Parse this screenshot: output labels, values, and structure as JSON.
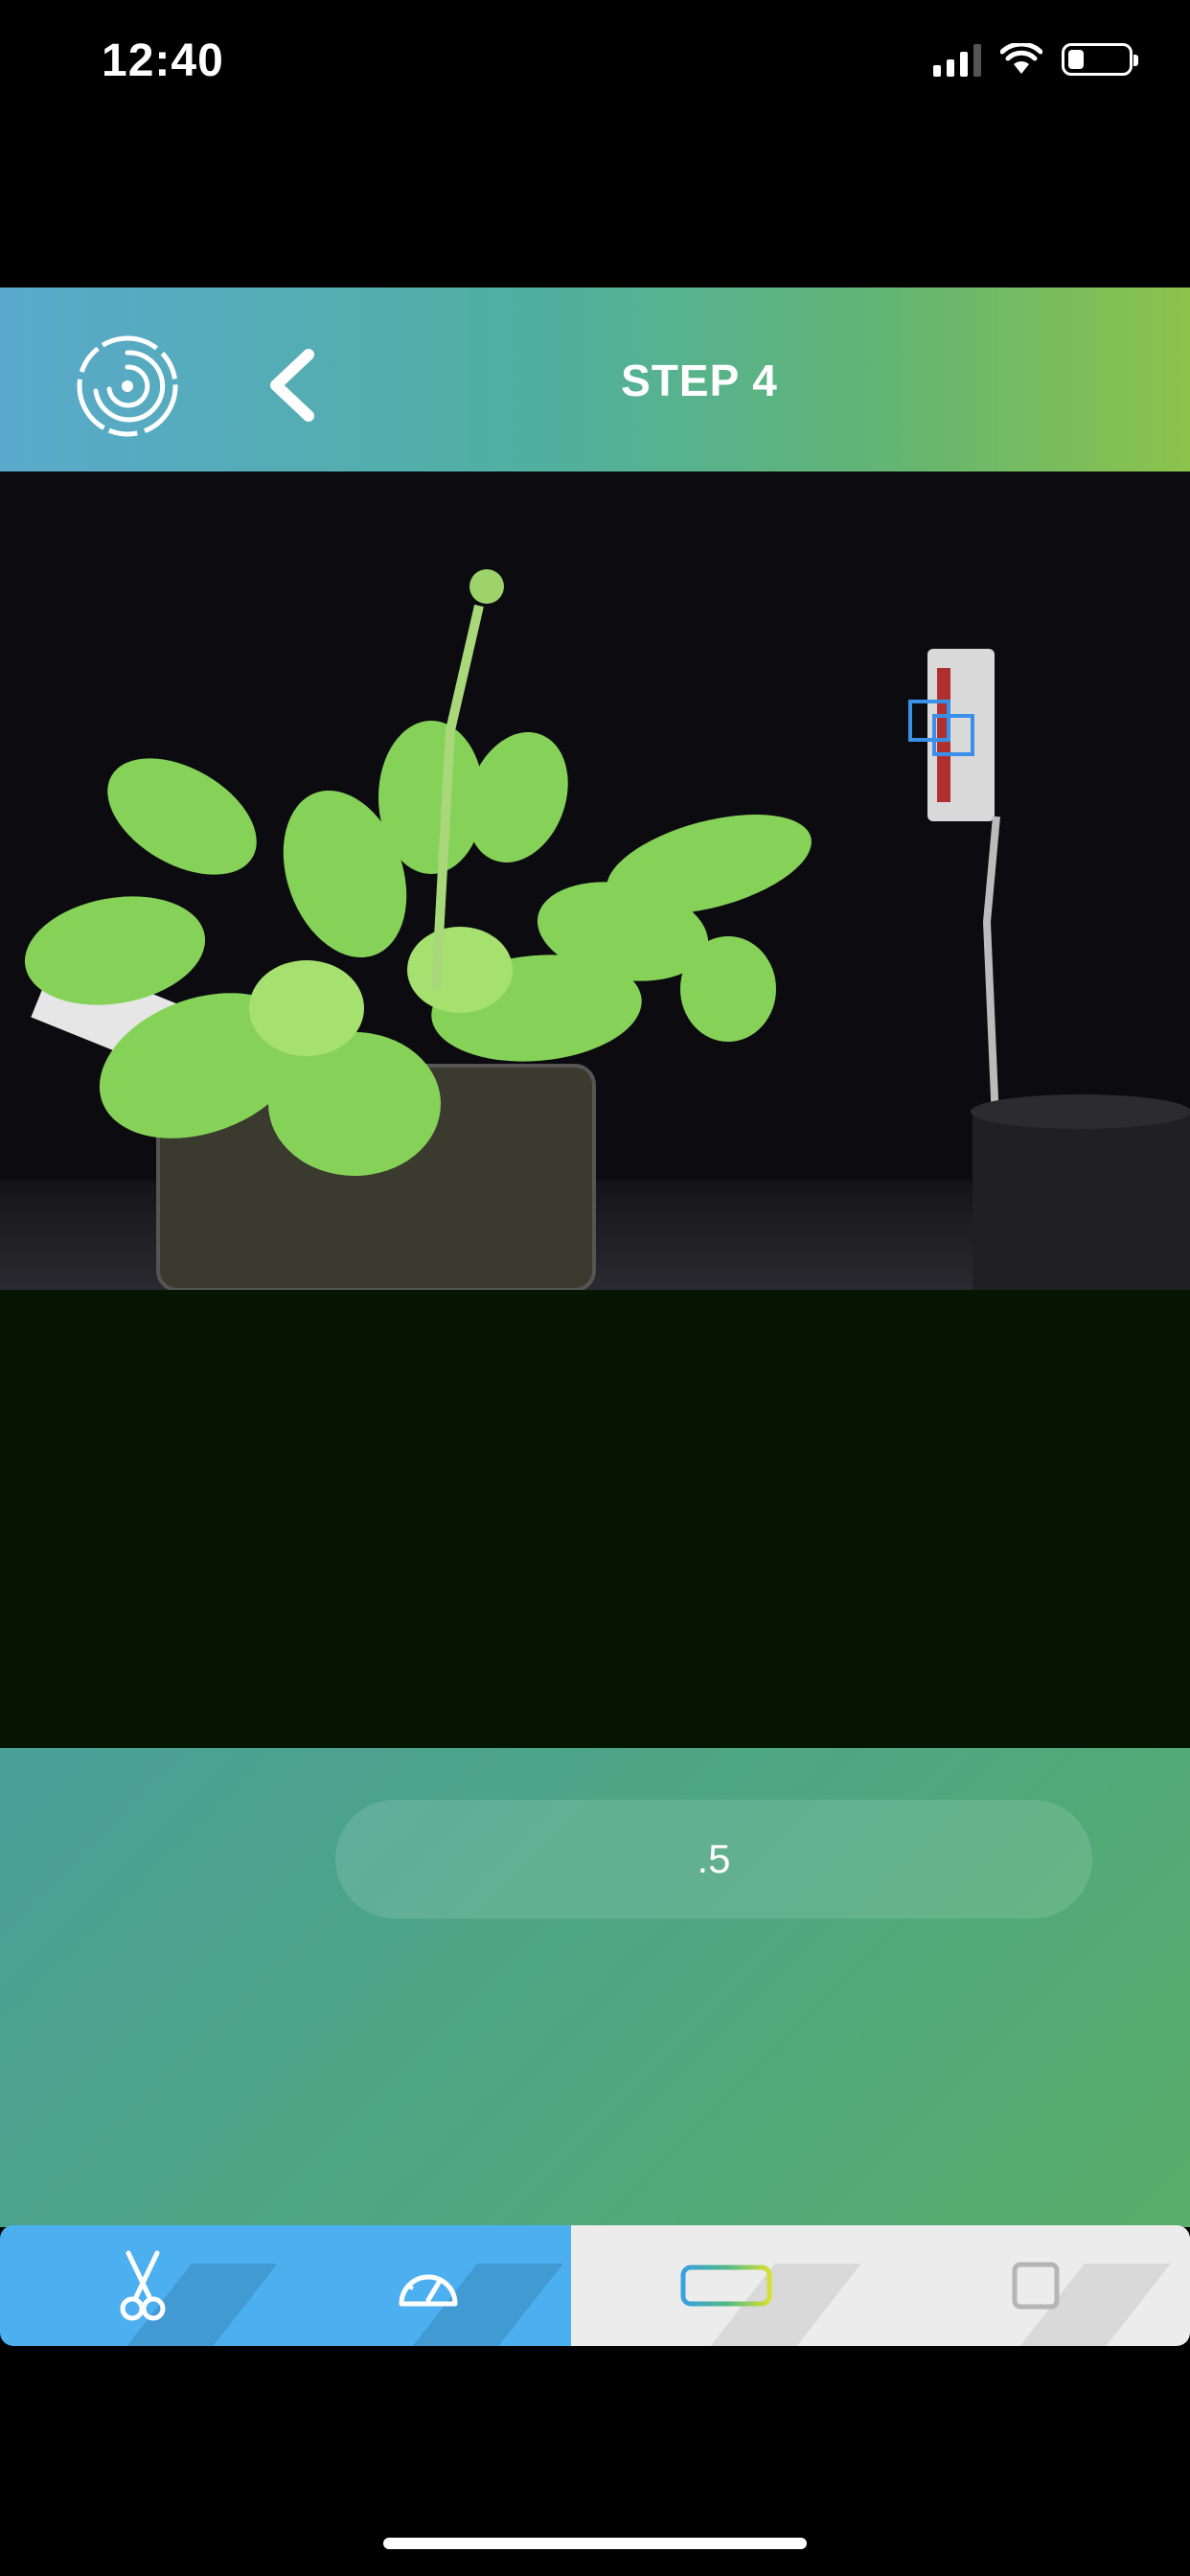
{
  "status_bar": {
    "time": "12:40"
  },
  "header": {
    "title": "STEP 4",
    "logo_icon": "swirl-logo-icon",
    "back_icon": "chevron-left-icon"
  },
  "photo": {
    "description_icon": "plant-photo"
  },
  "controls": {
    "value": ".5"
  },
  "tabbar": {
    "tabs": [
      {
        "icon": "scissors-icon",
        "active": true
      },
      {
        "icon": "speedometer-icon",
        "active": true
      },
      {
        "icon": "ruler-icon",
        "active": false
      },
      {
        "icon": "square-icon",
        "active": false
      }
    ]
  },
  "colors": {
    "header_gradient_start": "#5aa9cc",
    "header_gradient_end": "#8cc34b",
    "tab_active_bg": "#4cb0f0",
    "tab_inactive_bg": "#ececec",
    "controls_bg": "#4ea77f"
  }
}
